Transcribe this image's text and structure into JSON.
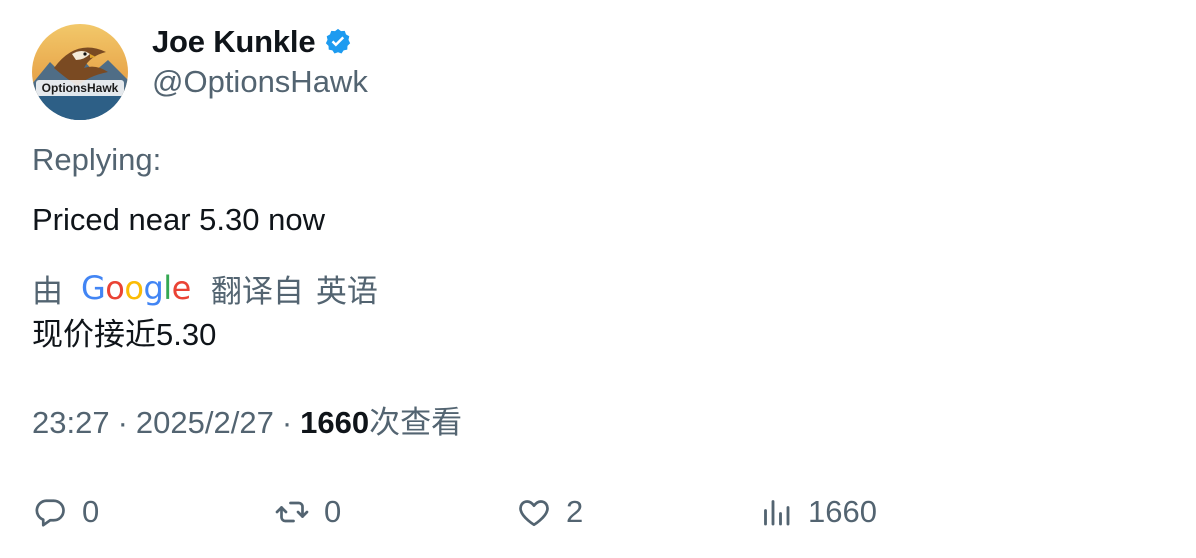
{
  "author": {
    "display_name": "Joe Kunkle",
    "handle": "@OptionsHawk",
    "verified": true,
    "avatar_logo_text": "OptionsHawk"
  },
  "replying_label": "Replying:",
  "tweet_text": "Priced near 5.30 now",
  "translation": {
    "by_label": "由",
    "provider": "Google",
    "translated_from_label": "翻译自",
    "language": "英语",
    "translated_text": "现价接近5.30"
  },
  "meta": {
    "time": "23:27",
    "separator": "·",
    "date": "2025/2/27",
    "views_count": "1660",
    "views_label": "次查看"
  },
  "actions": {
    "replies": "0",
    "retweets": "0",
    "likes": "2",
    "views": "1660"
  },
  "colors": {
    "primary_text": "#0f1419",
    "secondary_text": "#536471",
    "verified_blue": "#1d9bf0"
  },
  "icons": [
    "verified-badge-icon",
    "reply-icon",
    "retweet-icon",
    "like-icon",
    "views-icon"
  ]
}
